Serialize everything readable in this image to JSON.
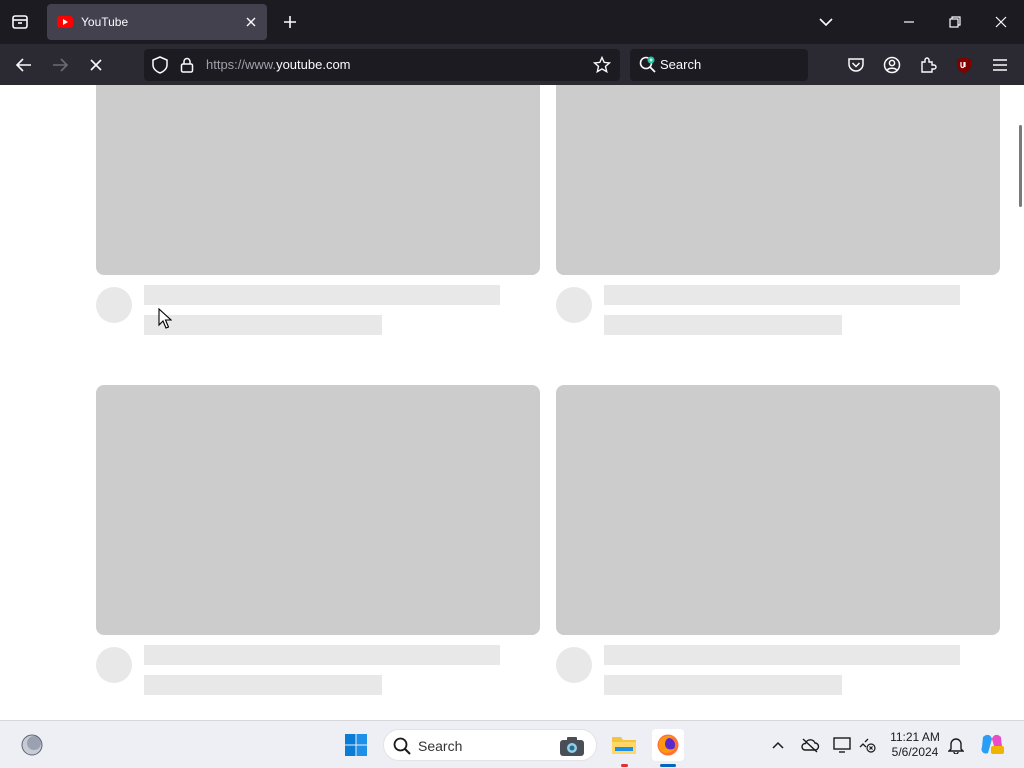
{
  "browser": {
    "tab": {
      "title": "YouTube"
    },
    "address": {
      "scheme": "https://www.",
      "host": "youtube.com"
    },
    "search": {
      "placeholder": "Search"
    }
  },
  "taskbar": {
    "search_placeholder": "Search",
    "clock": {
      "time": "11:21 AM",
      "date": "5/6/2024"
    }
  },
  "colors": {
    "tabbar_bg": "#1c1b22",
    "navbar_bg": "#2b2a33",
    "tab_active_bg": "#42414d",
    "skeleton_thumb": "#cccccc",
    "skeleton_line": "#e8e8e8",
    "youtube_red": "#ff0000"
  }
}
